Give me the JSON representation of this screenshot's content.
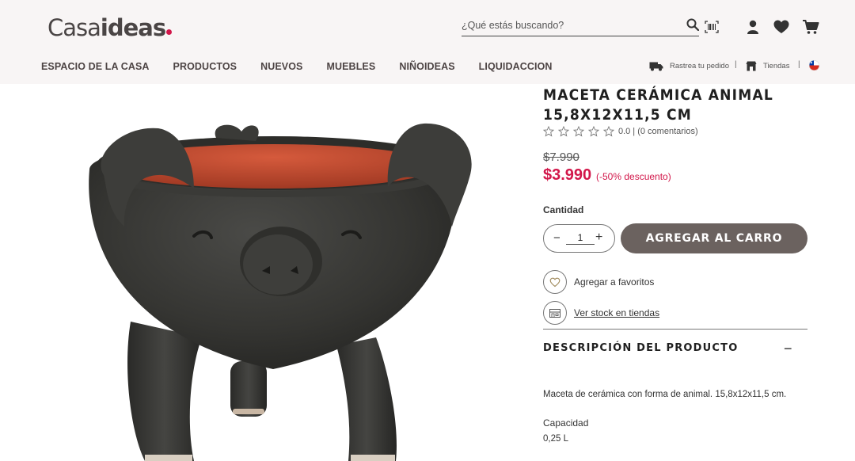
{
  "header": {
    "logo_part1": "Casa",
    "logo_part2": "ideas",
    "search_placeholder": "¿Qué estás buscando?",
    "nav": [
      "ESPACIO DE LA CASA",
      "PRODUCTOS",
      "NUEVOS",
      "MUEBLES",
      "NIÑOIDEAS",
      "LIQUIDACCION"
    ],
    "track_order": "Rastrea tu pedido",
    "stores": "Tiendas",
    "separator": "|"
  },
  "product": {
    "title": "MACETA CERÁMICA ANIMAL 15,8X12X11,5 CM",
    "rating_value": "0.0",
    "rating_comments": "| (0 comentarios)",
    "old_price": "$7.990",
    "new_price": "$3.990",
    "discount": "(-50% descuento)",
    "quantity_label": "Cantidad",
    "quantity": "1",
    "add_to_cart": "AGREGAR AL CARRO",
    "favorites": "Agregar a favoritos",
    "stock": "Ver stock en tiendas",
    "description_heading": "DESCRIPCIÓN DEL PRODUCTO",
    "description": "Maceta de cerámica con forma de animal. 15,8x12x11,5 cm.",
    "capacity_label": "Capacidad",
    "capacity_value": "0,25 L"
  },
  "colors": {
    "accent": "#d2174a",
    "button": "#6b625f",
    "header_bg": "#f8f5f5"
  },
  "icons": [
    "search-icon",
    "barcode-scan-icon",
    "user-icon",
    "heart-icon",
    "cart-icon",
    "truck-icon",
    "store-icon",
    "chile-flag-icon",
    "star-icon",
    "store-stock-icon"
  ]
}
